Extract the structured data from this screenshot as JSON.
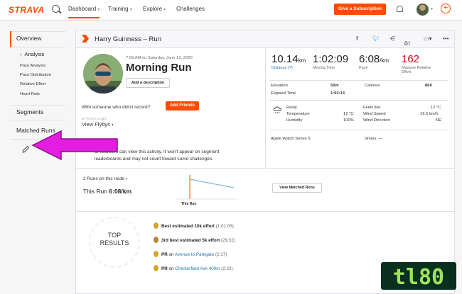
{
  "topnav": {
    "logo": "STRAVA",
    "items": [
      "Dashboard",
      "Training",
      "Explore",
      "Challenges"
    ],
    "subscribe": "Give a Subscription",
    "icons": [
      "search-icon",
      "bell-icon",
      "avatar",
      "plus-icon"
    ]
  },
  "sidebar": {
    "overview": "Overview",
    "analysis": "Analysis",
    "sub_items": [
      "Pace Analysis",
      "Pace Distribution",
      "Relative Effort",
      "Heart Rate"
    ],
    "segments": "Segments",
    "matched_runs": "Matched Runs"
  },
  "activity": {
    "header_title": "Harry Guinness – Run",
    "kudos_count": "0",
    "meta": "7:59 AM on Saturday, June 13, 2020",
    "title": "Morning Run",
    "add_description": "Add a description"
  },
  "stats": {
    "distance": {
      "value": "10.14",
      "unit": "km",
      "label": "Distance (?)"
    },
    "moving_time": {
      "value": "1:02:09",
      "label": "Moving Time"
    },
    "pace": {
      "value": "6:08",
      "unit": "/km",
      "label": "Pace"
    },
    "relative_effort": {
      "value": "162",
      "label1": "Massive Relative",
      "label2": "Effort"
    },
    "elevation_label": "Elevation",
    "elevation_value": "50m",
    "calories_label": "Calories",
    "calories_value": "869",
    "elapsed_label": "Elapsed Time",
    "elapsed_value": "1:02:13"
  },
  "weather": {
    "condition": "Rainy",
    "temperature_label": "Temperature",
    "temperature_value": "12 °C",
    "humidity_label": "Humidity",
    "humidity_value": "100%",
    "feels_label": "Feels like",
    "feels_value": "12 °C",
    "wind_speed_label": "Wind Speed",
    "wind_speed_value": "16.5 km/h",
    "wind_dir_label": "Wind Direction",
    "wind_dir_value": "NE"
  },
  "device": {
    "name": "Apple Watch Series 5",
    "shoes": "Shoes: —"
  },
  "social": {
    "prompt": "With someone who didn't record?",
    "add_friends": "Add Friends",
    "labs": "STRAVA LABS",
    "flybys": "View Flybys"
  },
  "privacy": {
    "line1": "ur followers can view this activity. It won't appear on segment",
    "line2": "leaderboards and may not count toward some challenges."
  },
  "matched": {
    "route": "2 Runs on this route",
    "this_run_label": "This Run",
    "this_run_pace": "6:08/km",
    "chart_label": "This Run",
    "view_button": "View Matched Runs"
  },
  "results": {
    "badge_line1": "TOP",
    "badge_line2": "RESULTS",
    "items": [
      {
        "medal": "gold",
        "prefix": "",
        "text": "Best estimated 10k effort",
        "link": "",
        "time": "(1:01:05)"
      },
      {
        "medal": "bronze",
        "prefix": "",
        "text": "3rd best estimated 5k effort",
        "link": "",
        "time": "(29:32)"
      },
      {
        "medal": "gold",
        "prefix": "PR",
        "text": " on ",
        "link": "Avenue to Parkgate",
        "time": "(2:17)"
      },
      {
        "medal": "gold",
        "prefix": "PR",
        "text": " on ",
        "link": "Chesterfield Ave 400m",
        "time": "(2:22)"
      }
    ]
  },
  "watermark": "tl80",
  "colors": {
    "brand": "#fc4c02",
    "arrow": "#e41ee1",
    "link": "#1976b0",
    "effort": "#d0021b"
  }
}
